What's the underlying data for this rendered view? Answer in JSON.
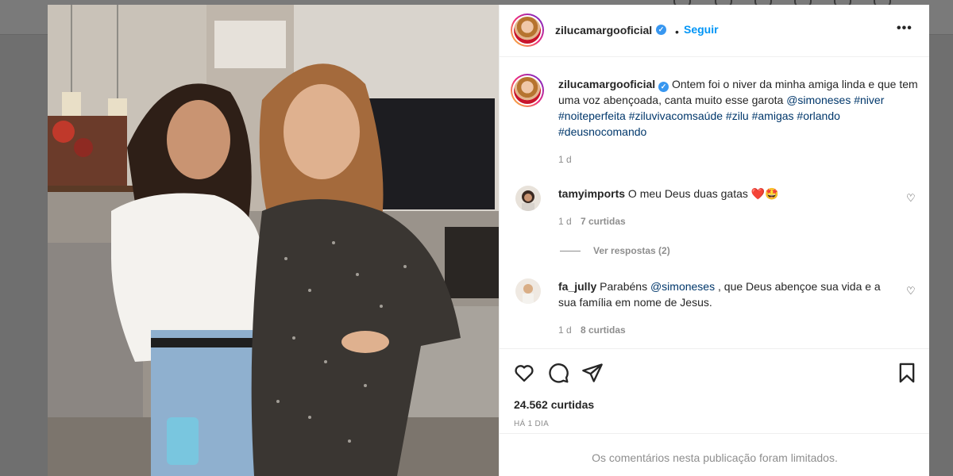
{
  "post": {
    "username": "zilucamargooficial",
    "follow_label": "Seguir",
    "more_label": "•••",
    "caption": {
      "text_before": "Ontem foi o niver da minha amiga linda e que tem uma voz abençoada, canta muito esse garota ",
      "mention": "@simoneses",
      "hashtags": [
        "#niver",
        "#noiteperfeita",
        "#ziluvivacomsaúde",
        "#zilu",
        "#amigas",
        "#orlando",
        "#deusnocomando"
      ],
      "time": "1 d"
    },
    "comments": [
      {
        "username": "tamyimports",
        "text": "O meu Deus duas gatas ❤️🤩",
        "time": "1 d",
        "likes": "7 curtidas"
      },
      {
        "username": "fa_jully",
        "text_before": "Parabéns ",
        "mention": "@simoneses",
        "text_after": " , que Deus abençoe sua vida e a sua família em nome de Jesus.",
        "time": "1 d",
        "likes": "8 curtidas"
      }
    ],
    "view_replies": "Ver respostas (2)",
    "likes_count": "24.562 curtidas",
    "time_ago": "HÁ 1 DIA",
    "comments_limited": "Os comentários nesta publicação foram limitados."
  },
  "icons": {
    "verified": "verified-badge-icon",
    "like": "heart-icon",
    "comment": "comment-icon",
    "share": "paper-plane-icon",
    "save": "bookmark-icon"
  },
  "colors": {
    "accent": "#0095f6",
    "link": "#00376b",
    "muted": "#8e8e8e",
    "verified": "#3897f0"
  }
}
